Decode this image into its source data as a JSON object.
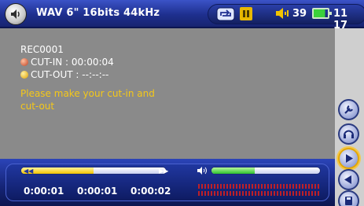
{
  "statusbar": {
    "title": "WAV 6\" 16bits 44kHz",
    "volume": "39",
    "clock": "11 17",
    "battery_level": 0.8,
    "icons": [
      "audio-icon",
      "repeat-icon",
      "pause-icon",
      "volume-icon",
      "battery-icon"
    ]
  },
  "recording": {
    "filename": "REC0001",
    "cut_in": "CUT-IN : 00:00:04",
    "cut_out": "CUT-OUT : --:--:--",
    "instruction": "Please make your cut-in and cut-out"
  },
  "controls": {
    "elapsed": "0:00:01",
    "position": "0:00:01",
    "total": "0:00:02",
    "progress": 0.5,
    "level": 0.4
  },
  "sidebar": {
    "buttons": [
      "wrench-icon",
      "headphones-icon",
      "play-icon",
      "back-icon",
      "save-icon"
    ]
  },
  "colors": {
    "accent": "#f5c818",
    "statusbar": "#1e2f8e",
    "background": "#8a8a8a"
  }
}
